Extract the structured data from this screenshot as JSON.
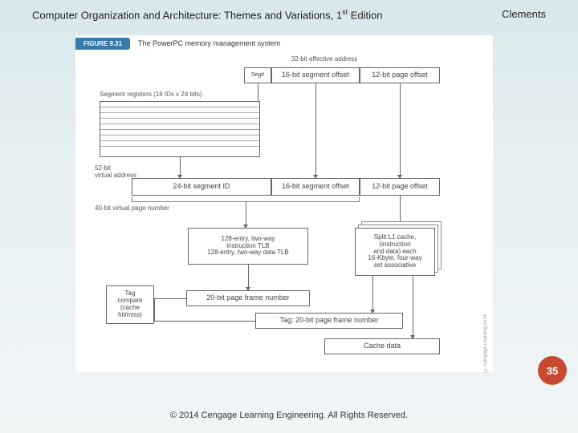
{
  "header": {
    "title_prefix": "Computer Organization and Architecture: Themes and Variations, 1",
    "title_sup": "st",
    "title_suffix": " Edition",
    "author": "Clements"
  },
  "figure": {
    "badge": "FIGURE 9.31",
    "caption": "The PowerPC memory management system",
    "eff_addr_label": "32-bit effective address",
    "ea_seg": "Seg#",
    "ea_segoff": "16-bit segment offset",
    "ea_pageoff": "12-bit page offset",
    "seg_regs_label": "Segment registers (16 IDs x 24 bits)",
    "va52_label": "52-bit\nvirtual address",
    "va_segid": "24-bit segment ID",
    "va_segoff": "16-bit segment offset",
    "va_pageoff": "12-bit page offset",
    "vpn_label": "40-bit virtual page number",
    "tlb_box": "128-entry, two-way\ninstruction TLB\n128-entry, two-way data TLB",
    "l1_box": "Split L1 cache,\n(instruction\nand data) each\n16-Kbyte, four-way\nset associative",
    "tagcmp_box": "Tag\ncompare\n(cache\nhit/miss)",
    "pfn_box": "20-bit page frame number",
    "tag_box": "Tag: 20-bit page frame number",
    "cache_data_box": "Cache data",
    "credit": "© Cengage Learning 2014"
  },
  "page_number": "35",
  "footer": "© 2014 Cengage Learning Engineering. All Rights Reserved."
}
